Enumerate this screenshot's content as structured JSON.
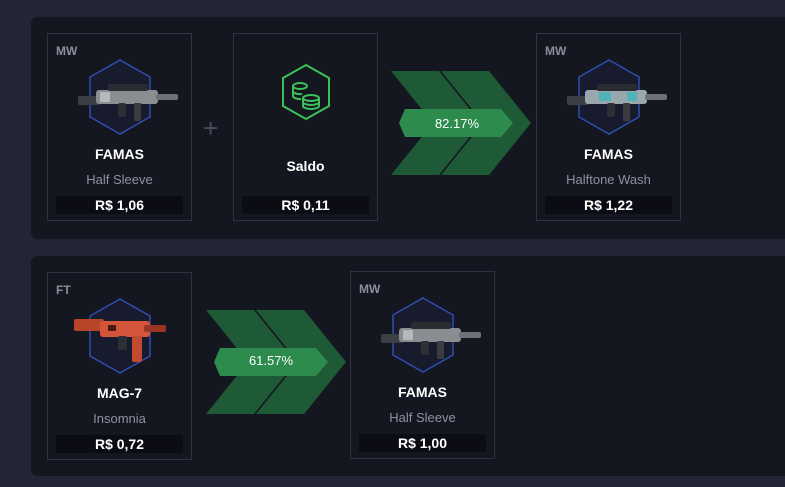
{
  "upgrades": [
    {
      "inputs": [
        {
          "condition": "MW",
          "weapon": "FAMAS",
          "skin": "Half Sleeve",
          "price": "R$ 1,06"
        },
        {
          "condition": "",
          "weapon": "Saldo",
          "skin": "",
          "price": "R$ 0,11",
          "icon": "coins-icon"
        }
      ],
      "chance": "82.17%",
      "result": {
        "condition": "MW",
        "weapon": "FAMAS",
        "skin": "Halftone Wash",
        "price": "R$ 1,22"
      }
    },
    {
      "inputs": [
        {
          "condition": "FT",
          "weapon": "MAG-7",
          "skin": "Insomnia",
          "price": "R$ 0,72"
        }
      ],
      "chance": "61.57%",
      "result": {
        "condition": "MW",
        "weapon": "FAMAS",
        "skin": "Half Sleeve",
        "price": "R$ 1,00"
      }
    }
  ],
  "plus_symbol": "+",
  "colors": {
    "background": "#222536",
    "panel": "#141620",
    "accent_green": "#2e8b4e",
    "hex_outline": "#2b4a9e"
  }
}
